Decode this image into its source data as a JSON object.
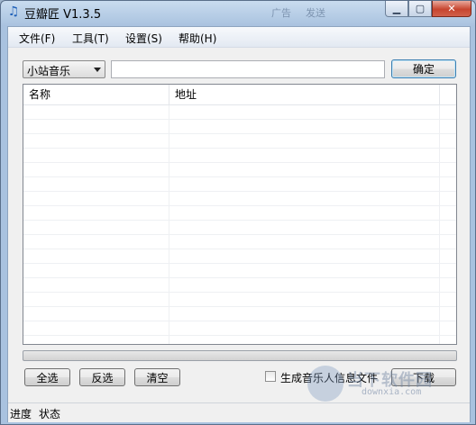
{
  "window": {
    "title": "豆瓣匠 V1.3.5",
    "app_icon": "music-note-icon",
    "background_ghost_text": [
      "广告",
      "发送"
    ]
  },
  "caption_buttons": {
    "minimize_icon": "minimize-icon",
    "maximize_icon": "maximize-icon",
    "close_icon": "close-icon"
  },
  "menu": {
    "items": [
      {
        "label": "文件(F)"
      },
      {
        "label": "工具(T)"
      },
      {
        "label": "设置(S)"
      },
      {
        "label": "帮助(H)"
      }
    ]
  },
  "source_select": {
    "value": "小站音乐",
    "icon": "chevron-down-icon"
  },
  "url_input": {
    "value": "",
    "placeholder": ""
  },
  "buttons": {
    "confirm": "确定",
    "select_all": "全选",
    "invert": "反选",
    "clear": "清空",
    "download": "下载"
  },
  "table": {
    "columns": [
      "名称",
      "地址"
    ],
    "rows": []
  },
  "progress": {
    "value": 0
  },
  "checkbox": {
    "label": "生成音乐人信息文件",
    "checked": false
  },
  "status_bar": {
    "progress_label": "进度",
    "state_label": "状态"
  },
  "watermark": {
    "text": "当下软件园",
    "url": "downxia.com"
  },
  "colors": {
    "window_frame": "#a9c2df",
    "close_button": "#c7452f",
    "default_button_border": "#3c7fb1"
  }
}
